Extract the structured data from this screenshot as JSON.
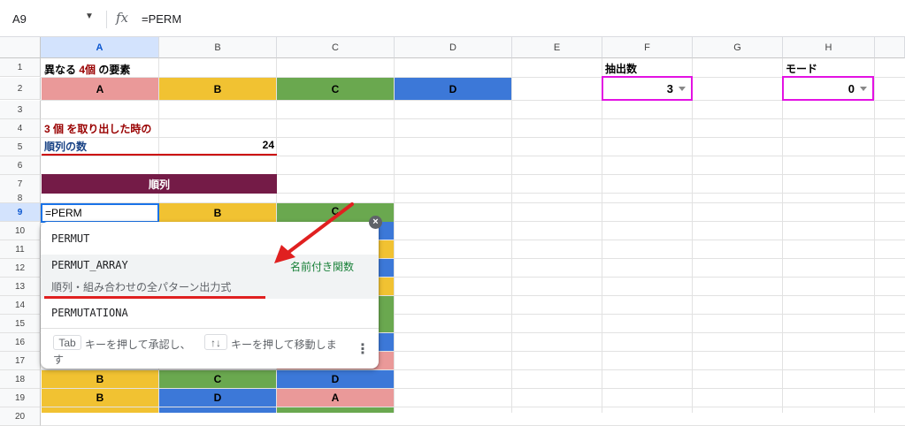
{
  "formula_bar": {
    "name_box": "A9",
    "fx": "fx",
    "content": "=PERM"
  },
  "columns": [
    "A",
    "B",
    "C",
    "D",
    "E",
    "F",
    "G",
    "H"
  ],
  "rows": [
    "1",
    "2",
    "3",
    "4",
    "5",
    "6",
    "7",
    "8",
    "9",
    "10",
    "11",
    "12",
    "13",
    "14",
    "15",
    "16",
    "17",
    "18",
    "19",
    "20"
  ],
  "sheet": {
    "r1_prefix": "異なる",
    "r1_count": "4個",
    "r1_suffix": "の要素",
    "f1": "抽出数",
    "h1": "モード",
    "elements": [
      "A",
      "B",
      "C",
      "D"
    ],
    "f2_value": "3",
    "h2_value": "0",
    "r4": "3 個 を取り出した時の",
    "r5_label": "順列の数",
    "r5_value": "24",
    "r7_header": "順列",
    "editing_cell": "=PERM",
    "row9": [
      "B",
      "C"
    ],
    "row18": [
      "B",
      "C",
      "D"
    ],
    "row19": [
      "B",
      "D",
      "A"
    ]
  },
  "autocomplete": {
    "items": [
      "PERMUT",
      "PERMUT_ARRAY",
      "PERMUTATIONA"
    ],
    "named_function_tag": "名前付き関数",
    "description": "順列・組み合わせの全パターン出力式",
    "footer_tab": "Tab",
    "footer_text1": "キーを押して承認し、",
    "footer_arrows": "↑↓",
    "footer_text2": "キーを押して移動しま",
    "footer_text3": "す",
    "more": "⋮",
    "close": "×"
  },
  "colors": {
    "A": "#ea9999",
    "B": "#f1c232",
    "C": "#6aa84f",
    "D": "#3c78d8",
    "header": "#741b47",
    "highlight": "#e312e3",
    "dark_red": "#990000",
    "blue_text": "#1c4587",
    "arrow": "#e02020"
  }
}
